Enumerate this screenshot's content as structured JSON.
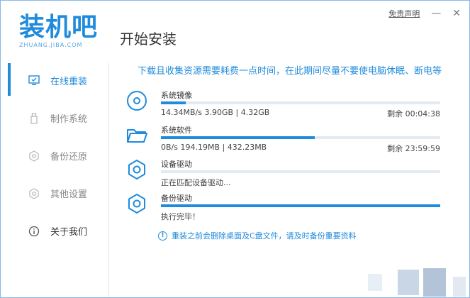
{
  "brand": {
    "logo_text": "装机吧",
    "logo_sub": "ZHUANG.JIBA.COM"
  },
  "header": {
    "title": "开始安装",
    "disclaimer": "免责声明",
    "minimize": "—",
    "close": "✕"
  },
  "sidebar": {
    "items": [
      {
        "label": "在线重装",
        "icon": "monitor-icon",
        "state": "active"
      },
      {
        "label": "制作系统",
        "icon": "usb-icon",
        "state": "disabled"
      },
      {
        "label": "备份还原",
        "icon": "backup-icon",
        "state": "disabled"
      },
      {
        "label": "其他设置",
        "icon": "gear-icon",
        "state": "disabled"
      },
      {
        "label": "关于我们",
        "icon": "info-icon",
        "state": "normal"
      }
    ]
  },
  "notice": "下载且收集资源需要耗费一点时间，在此期间尽量不要使电脑休眠、断电等",
  "tasks": [
    {
      "name": "系统镜像",
      "detail": "14.34MB/s 3.90GB | 4.32GB",
      "remaining": "剩余 00:04:38",
      "progress": 0.09,
      "icon": "disc-icon"
    },
    {
      "name": "系统软件",
      "detail": "0B/s 194.19MB | 432.23MB",
      "remaining": "剩余 23:59:59",
      "progress": 0.55,
      "icon": "folder-icon"
    },
    {
      "name": "设备驱动",
      "detail": "正在匹配设备驱动...",
      "remaining": "",
      "progress": 0,
      "icon": "gear-icon"
    },
    {
      "name": "备份驱动",
      "detail": "执行完毕！",
      "remaining": "",
      "progress": 1.0,
      "icon": "gear-icon"
    }
  ],
  "warning": {
    "icon_char": "!",
    "text": "重装之前会删除桌面及C盘文件，请及时备份重要资料"
  },
  "colors": {
    "accent": "#1f8bdc",
    "track": "#e3eaf2"
  }
}
